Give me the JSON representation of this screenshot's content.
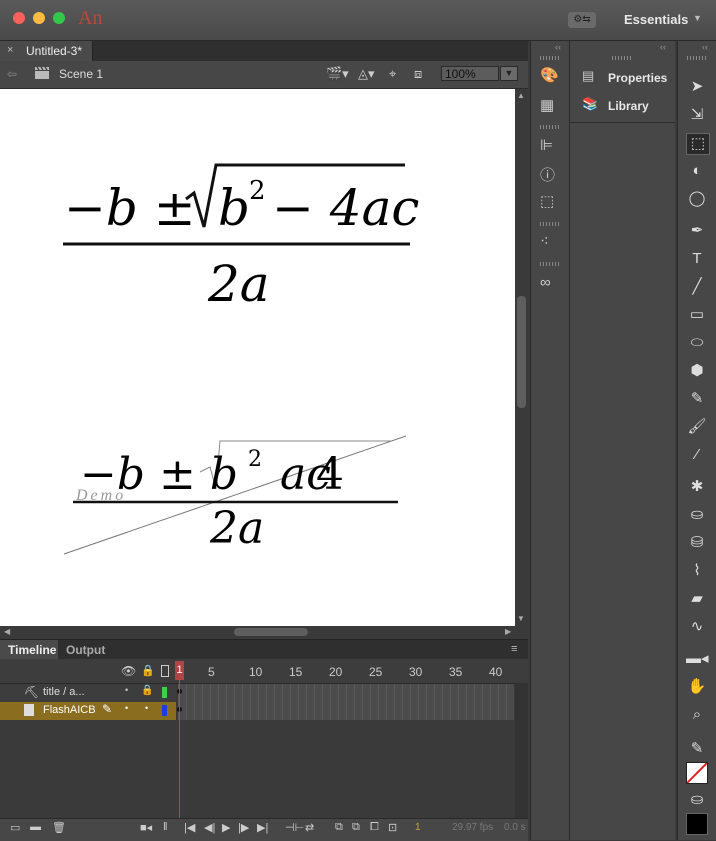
{
  "app": {
    "logo": "An",
    "workspace_label": "Essentials",
    "workspace_icon": "⚙⇆"
  },
  "document": {
    "tab_title": "Untitled-3*",
    "close_glyph": "×"
  },
  "editbar": {
    "scene_label": "Scene 1",
    "zoom": "100%"
  },
  "stage": {
    "formula_top": {
      "numerator_prefix": "−b ±",
      "radical": "√",
      "b": "b",
      "exp": "2",
      "rest": "− 4ac",
      "denominator": "2a"
    },
    "formula_bottom": {
      "lead": "−b ± b",
      "radical": "√",
      "exp": "2",
      "ac": "ac",
      "four": "4",
      "denominator": "2a",
      "watermark": "Demo"
    }
  },
  "timeline": {
    "tab_timeline": "Timeline",
    "tab_output": "Output",
    "frame_numbers": [
      "1",
      "5",
      "10",
      "15",
      "20",
      "25",
      "30",
      "35",
      "40"
    ],
    "layers": [
      {
        "name": "title / a...",
        "color": "#3ad24a"
      },
      {
        "name": "FlashAICB",
        "color": "#1e3ae0"
      }
    ],
    "fps": "29.97 fps",
    "time": "0.0 s",
    "current_frame": "1"
  },
  "panels": {
    "properties": "Properties",
    "library": "Library"
  },
  "colors": {
    "accent_layer": "#8a6d1f",
    "playhead": "#c04040",
    "stroke_swatch": "#ffffff",
    "fill_swatch": "#000000"
  }
}
